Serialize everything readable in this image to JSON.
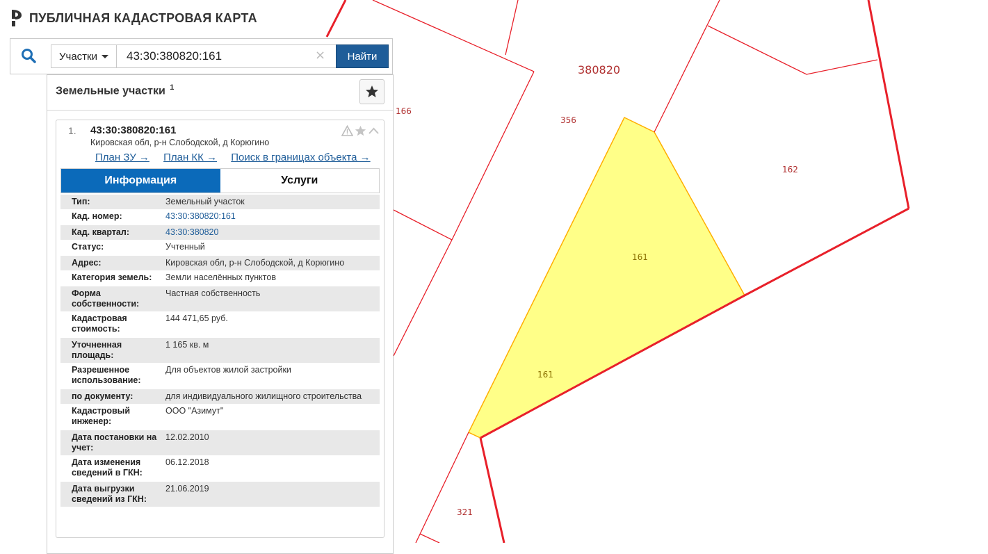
{
  "header": {
    "title": "ПУБЛИЧНАЯ КАДАСТРОВАЯ КАРТА"
  },
  "search": {
    "type_label": "Участки",
    "query": "43:30:380820:161",
    "clear_symbol": "×",
    "button": "Найти"
  },
  "results": {
    "title": "Земельные участки",
    "count": "1",
    "item": {
      "index": "1.",
      "cadastral_number": "43:30:380820:161",
      "address": "Кировская обл, р-н Слободской, д Корюгино",
      "links": [
        "План ЗУ →",
        "План КК →",
        "Поиск в границах объекта →"
      ],
      "tabs": {
        "info": "Информация",
        "services": "Услуги"
      },
      "info": [
        {
          "k": "Тип:",
          "v": "Земельный участок"
        },
        {
          "k": "Кад. номер:",
          "v": "43:30:380820:161",
          "link": true
        },
        {
          "k": "Кад. квартал:",
          "v": "43:30:380820",
          "link": true
        },
        {
          "k": "Статус:",
          "v": "Учтенный"
        },
        {
          "k": "Адрес:",
          "v": "Кировская обл, р-н Слободской, д Корюгино"
        },
        {
          "k": "Категория земель:",
          "v": "Земли населённых пунктов"
        },
        {
          "k": "Форма собственности:",
          "v": "Частная собственность"
        },
        {
          "k": "Кадастровая стоимость:",
          "v": "144 471,65 руб."
        },
        {
          "k": "Уточненная площадь:",
          "v": "1 165 кв. м"
        },
        {
          "k": "Разрешенное использование:",
          "v": "Для объектов жилой застройки"
        },
        {
          "k": "по документу:",
          "v": "для индивидуального жилищного строительства"
        },
        {
          "k": "Кадастровый инженер:",
          "v": "ООО \"Азимут\""
        },
        {
          "k": "Дата постановки на учет:",
          "v": "12.02.2010"
        },
        {
          "k": "Дата изменения сведений в ГКН:",
          "v": "06.12.2018"
        },
        {
          "k": "Дата выгрузки сведений из ГКН:",
          "v": "21.06.2019"
        }
      ]
    }
  },
  "map": {
    "quarter_label": "380820",
    "parcel_labels": [
      "166",
      "356",
      "162",
      "161",
      "161",
      "321"
    ],
    "colors": {
      "boundary": "#e8202a",
      "selected_fill": "#ffff88",
      "selected_stroke": "#ffb000"
    }
  }
}
